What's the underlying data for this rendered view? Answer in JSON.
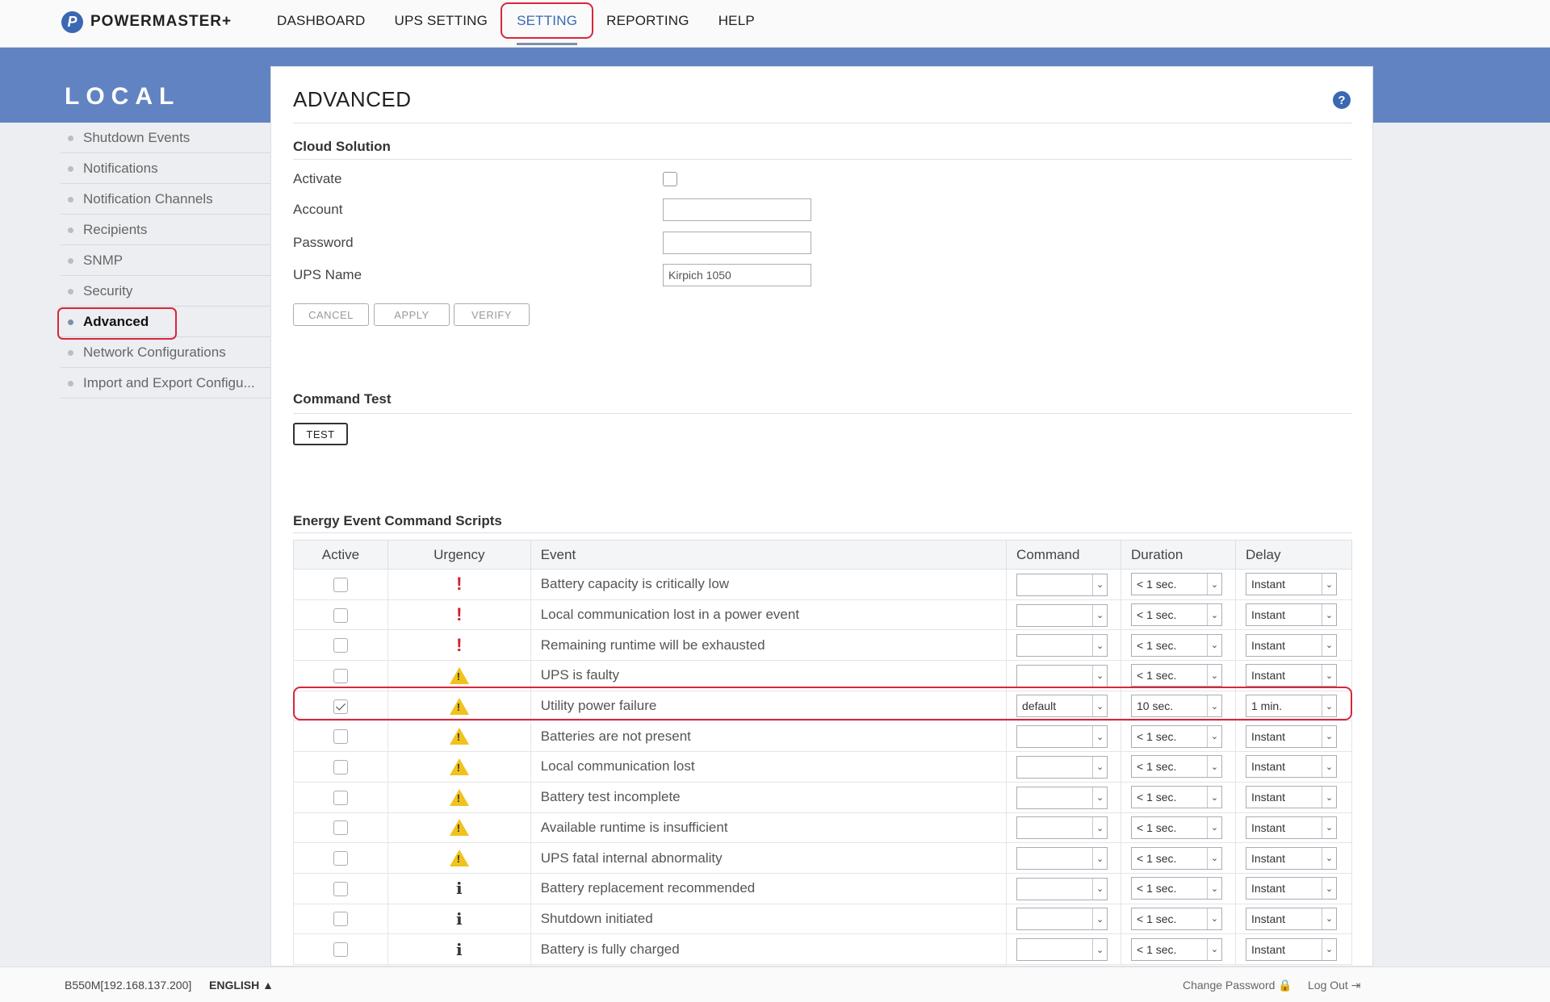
{
  "brand": {
    "name": "POWERMASTER+",
    "mark": "P"
  },
  "nav": {
    "items": [
      {
        "label": "DASHBOARD"
      },
      {
        "label": "UPS SETTING"
      },
      {
        "label": "SETTING"
      },
      {
        "label": "REPORTING"
      },
      {
        "label": "HELP"
      }
    ],
    "active": "SETTING"
  },
  "section_title": "LOCAL",
  "sidebar": {
    "items": [
      {
        "label": "Shutdown Events"
      },
      {
        "label": "Notifications"
      },
      {
        "label": "Notification Channels"
      },
      {
        "label": "Recipients"
      },
      {
        "label": "SNMP"
      },
      {
        "label": "Security"
      },
      {
        "label": "Advanced"
      },
      {
        "label": "Network Configurations"
      },
      {
        "label": "Import and Export Configu..."
      }
    ],
    "active": "Advanced"
  },
  "page_title": "ADVANCED",
  "help_glyph": "?",
  "cloud": {
    "title": "Cloud Solution",
    "activate_label": "Activate",
    "account_label": "Account",
    "account_value": "",
    "password_label": "Password",
    "password_value": "",
    "ups_name_label": "UPS Name",
    "ups_name_value": "Kirpich 1050",
    "cancel": "CANCEL",
    "apply": "APPLY",
    "verify": "VERIFY"
  },
  "command_test": {
    "title": "Command Test",
    "test": "TEST"
  },
  "scripts": {
    "title": "Energy Event Command Scripts",
    "headers": {
      "active": "Active",
      "urgency": "Urgency",
      "event": "Event",
      "command": "Command",
      "duration": "Duration",
      "delay": "Delay"
    },
    "rows": [
      {
        "active": false,
        "urgency": "critical",
        "event": "Battery capacity is critically low",
        "command": "",
        "duration": "< 1 sec.",
        "delay": "Instant"
      },
      {
        "active": false,
        "urgency": "critical",
        "event": "Local communication lost in a power event",
        "command": "",
        "duration": "< 1 sec.",
        "delay": "Instant"
      },
      {
        "active": false,
        "urgency": "critical",
        "event": "Remaining runtime will be exhausted",
        "command": "",
        "duration": "< 1 sec.",
        "delay": "Instant"
      },
      {
        "active": false,
        "urgency": "warning",
        "event": "UPS is faulty",
        "command": "",
        "duration": "< 1 sec.",
        "delay": "Instant"
      },
      {
        "active": true,
        "urgency": "warning",
        "event": "Utility power failure",
        "command": "default",
        "duration": "10 sec.",
        "delay": "1 min."
      },
      {
        "active": false,
        "urgency": "warning",
        "event": "Batteries are not present",
        "command": "",
        "duration": "< 1 sec.",
        "delay": "Instant"
      },
      {
        "active": false,
        "urgency": "warning",
        "event": "Local communication lost",
        "command": "",
        "duration": "< 1 sec.",
        "delay": "Instant"
      },
      {
        "active": false,
        "urgency": "warning",
        "event": "Battery test incomplete",
        "command": "",
        "duration": "< 1 sec.",
        "delay": "Instant"
      },
      {
        "active": false,
        "urgency": "warning",
        "event": "Available runtime is insufficient",
        "command": "",
        "duration": "< 1 sec.",
        "delay": "Instant"
      },
      {
        "active": false,
        "urgency": "warning",
        "event": "UPS fatal internal abnormality",
        "command": "",
        "duration": "< 1 sec.",
        "delay": "Instant"
      },
      {
        "active": false,
        "urgency": "info",
        "event": "Battery replacement recommended",
        "command": "",
        "duration": "< 1 sec.",
        "delay": "Instant"
      },
      {
        "active": false,
        "urgency": "info",
        "event": "Shutdown initiated",
        "command": "",
        "duration": "< 1 sec.",
        "delay": "Instant"
      },
      {
        "active": false,
        "urgency": "info",
        "event": "Battery is fully charged",
        "command": "",
        "duration": "< 1 sec.",
        "delay": "Instant"
      }
    ]
  },
  "footer": {
    "host": "B550M[192.168.137.200]",
    "language": "ENGLISH",
    "change_password": "Change Password",
    "logout": "Log Out"
  },
  "colors": {
    "accent": "#3a68b3",
    "band": "#6183c2",
    "highlight": "#d9263a",
    "warning": "#f1c21b",
    "critical": "#d01f32"
  }
}
